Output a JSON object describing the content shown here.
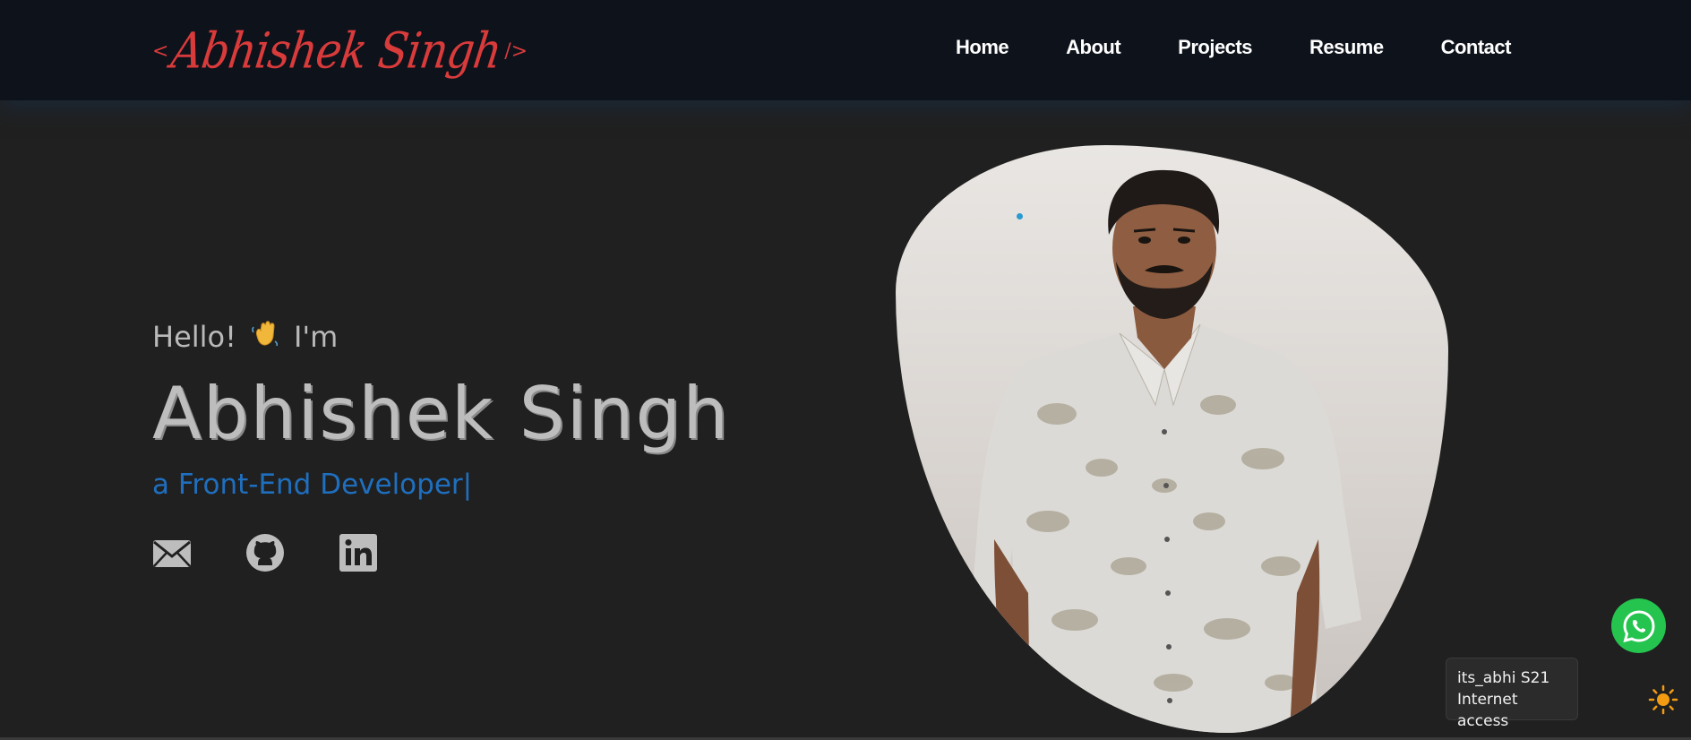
{
  "logo": {
    "open_bracket": "<",
    "name": "Abhishek Singh",
    "close_bracket": "/>",
    "color": "#d93b3b"
  },
  "nav": {
    "items": [
      {
        "label": "Home"
      },
      {
        "label": "About"
      },
      {
        "label": "Projects"
      },
      {
        "label": "Resume"
      },
      {
        "label": "Contact"
      }
    ]
  },
  "hero": {
    "greeting_start": "Hello!",
    "wave_icon": "waving-hand-icon",
    "greeting_end": "I'm",
    "name": "Abhishek Singh",
    "subtitle": "a Front-End Developer",
    "caret": "|",
    "accent_color": "#1f6fbf",
    "socials": [
      {
        "icon": "mail-icon"
      },
      {
        "icon": "github-icon"
      },
      {
        "icon": "linkedin-icon"
      }
    ]
  },
  "portrait": {
    "description": "profile-photo"
  },
  "floating": {
    "whatsapp_icon": "whatsapp-icon",
    "whatsapp_color": "#25c44f",
    "tooltip_line1": "its_abhi S21",
    "tooltip_line2": "Internet access",
    "theme_icon": "sun-icon",
    "theme_color": "#f39c12"
  }
}
